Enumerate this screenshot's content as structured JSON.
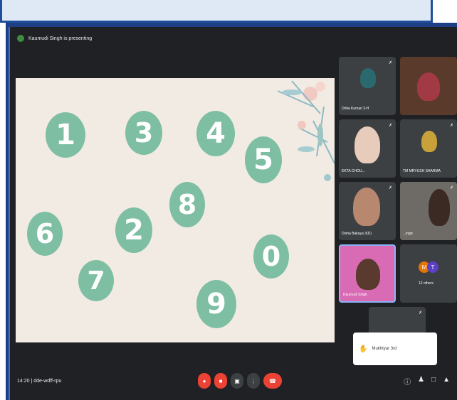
{
  "presenter_banner": "Kaumudi Singh is presenting",
  "slide_numbers": [
    "1",
    "3",
    "4",
    "5",
    "8",
    "6",
    "2",
    "0",
    "7",
    "9"
  ],
  "tiles": [
    {
      "name": "Dhita Kumari 3-H"
    },
    {
      "name": ""
    },
    {
      "name": "EKTA CHOU..."
    },
    {
      "name": "TM MRYUSH SHARMA"
    },
    {
      "name": "Disha Bakaya 3(D)"
    },
    {
      "name": "...ingh"
    },
    {
      "name": "Kaumudi Singh"
    },
    {
      "name": "12 others"
    }
  ],
  "others_avatars": [
    "M",
    "T"
  ],
  "notification": "Mukhtyar 3rd",
  "meeting_info": "14:20 | dde-wdff-rpu",
  "colors": {
    "accent": "#7ebfa3",
    "end_call": "#ea4335",
    "frame": "#1e3f86"
  }
}
